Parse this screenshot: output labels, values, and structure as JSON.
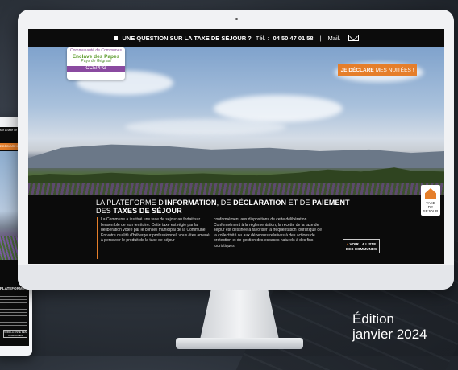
{
  "topbar": {
    "question": "UNE QUESTION SUR LA TAXE DE SÉJOUR ?",
    "tel_label": "Tél. :",
    "tel_number": "04 50 47 01 58",
    "separator": "|",
    "mail_label": "Mail. :"
  },
  "logo": {
    "line1": "Communauté de Communes",
    "line2": "Enclave des Papes",
    "line3": "Pays de Grignan",
    "line4": "CCEPPG"
  },
  "cta": {
    "bold": "JE DÉCLARE",
    "rest": "MES NUITÉES !"
  },
  "heading": {
    "part1": "LA PLATEFORME D'",
    "bold1": "INFORMATION",
    "part2": ", DE ",
    "bold2": "DÉCLARATION",
    "part3": " ET DE ",
    "bold3": "PAIEMENT",
    "part4": "DES ",
    "bold4": "TAXES DE SÉJOUR"
  },
  "body": {
    "col1": "La Commune a institué une taxe de séjour au forfait sur l'ensemble de son territoire. Cette taxe est régie par la délibération votée par le conseil municipal de la Commune. En votre qualité d'hébergeur professionnel, vous êtes amené à percevoir le produit de la taxe de séjour",
    "col2": "conformément aux dispositions de cette délibération. Conformément à la réglementation, la recette de la taxe de séjour est destinée à favoriser la fréquentation touristique de la collectivité ou aux dépenses relatives à des actions de protection et de gestion des espaces naturels à des fins touristiques."
  },
  "list_button": {
    "line1": "VOIR LA LISTE",
    "line2": "DES COMMUNES",
    "arrow": "»"
  },
  "badge": {
    "line1": "TAXE",
    "line2": "DE",
    "line3": "SÉJOUR"
  },
  "tablet": {
    "top_text": "sur la taxe de séjour",
    "cta": "JE DÉCLARE MES NUITÉES !",
    "title": "PLATEFORME",
    "button": "VOIR LA LISTE DES COMMUNES"
  },
  "edition": {
    "line1": "Édition",
    "line2": "janvier 2024"
  },
  "colors": {
    "accent": "#e57e2a",
    "bar": "#0c0c0c",
    "brand_purple": "#8a4aa0"
  }
}
